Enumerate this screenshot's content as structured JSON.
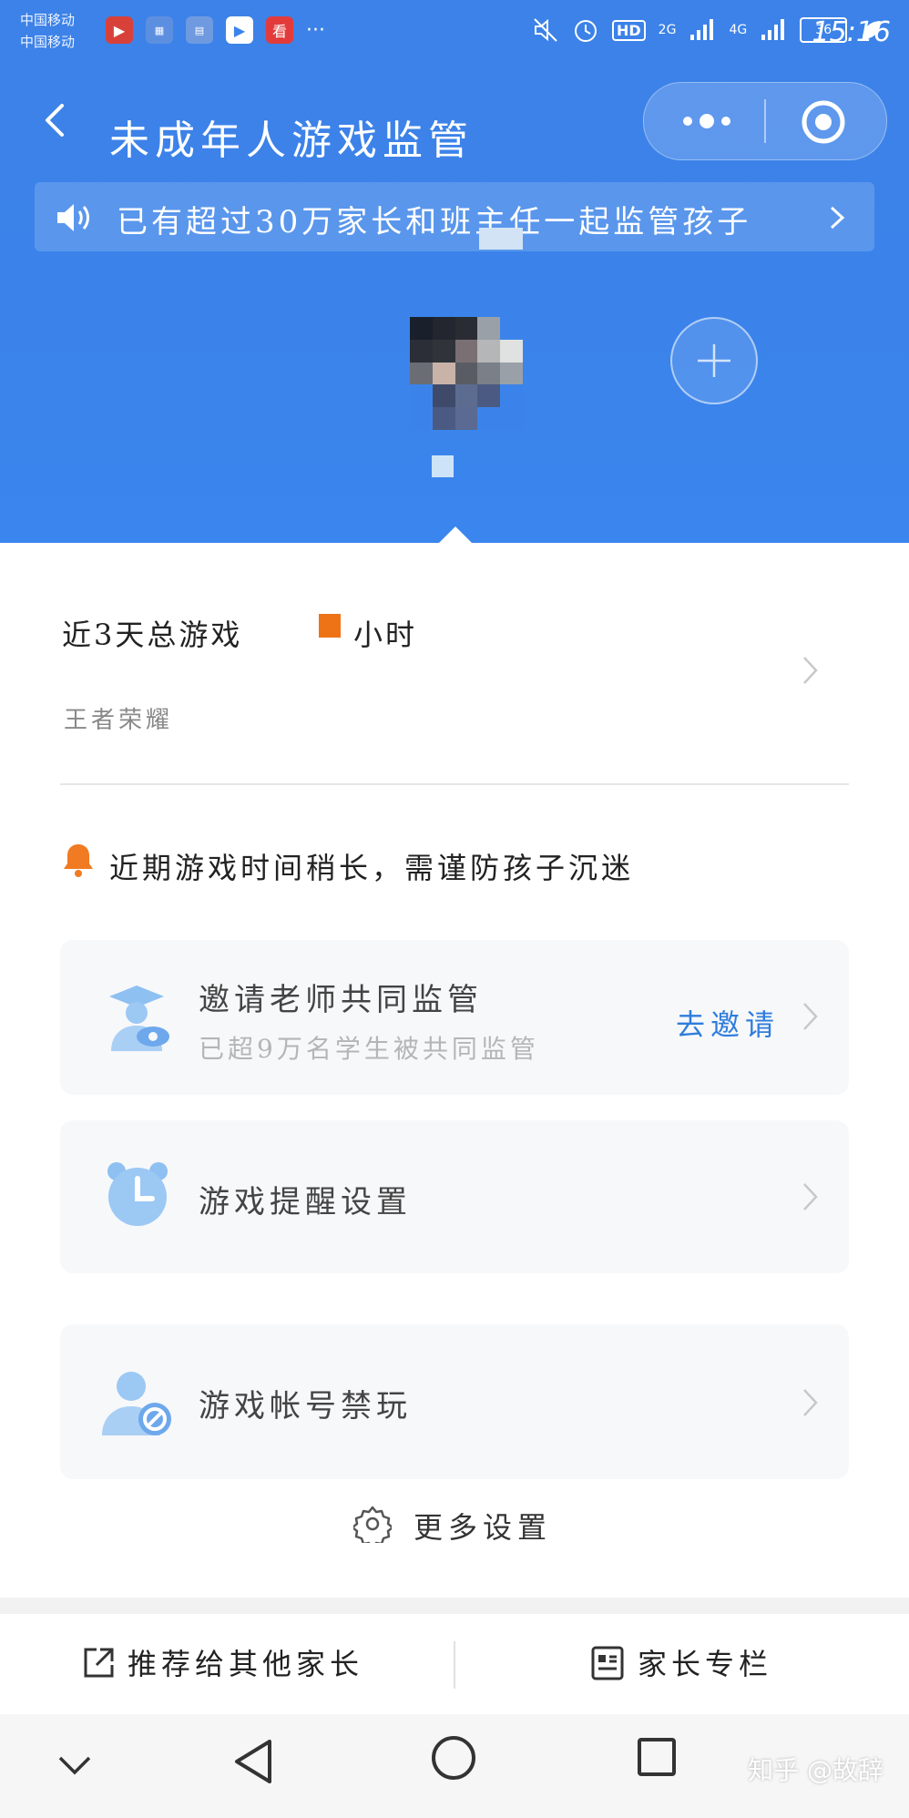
{
  "status_bar": {
    "carrier_1": "中国移动",
    "carrier_2": "中国移动",
    "more": "···",
    "hd": "HD",
    "signal_1": "2G",
    "signal_2": "4G",
    "battery": "36",
    "time": "15:16"
  },
  "nav": {
    "title": "未成年人游戏监管"
  },
  "notice": {
    "text": "已有超过30万家长和班主任一起监管孩子"
  },
  "stats": {
    "summary_prefix": "近3天总游戏",
    "summary_suffix": "小时",
    "game_name": "王者荣耀"
  },
  "warning": {
    "text": "近期游戏时间稍长，需谨防孩子沉迷"
  },
  "cards": {
    "invite": {
      "title": "邀请老师共同监管",
      "subtitle": "已超9万名学生被共同监管",
      "action": "去邀请"
    },
    "reminder": {
      "title": "游戏提醒设置"
    },
    "ban": {
      "title": "游戏帐号禁玩"
    }
  },
  "more_settings": {
    "label": "更多设置"
  },
  "bottom_bar": {
    "recommend": "推荐给其他家长",
    "column": "家长专栏"
  },
  "watermark": "知乎 @故辞",
  "colors": {
    "header_blue": "#3b83ea",
    "accent_orange": "#ee7317",
    "link_blue": "#2f7ddc",
    "icon_blue": "#7fb3f0"
  }
}
